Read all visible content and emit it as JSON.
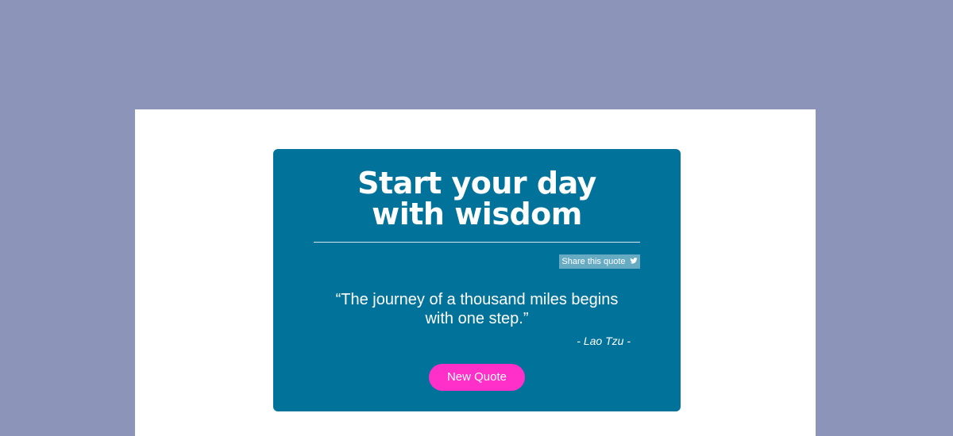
{
  "card": {
    "title_line1": "Start your day",
    "title_line2": "with wisdom",
    "share_label": "Share this quote",
    "share_icon": "twitter-bird-icon",
    "quote_line1": "“The journey of a thousand miles begins",
    "quote_line2": "with one step.”",
    "author": "- Lao Tzu -",
    "new_quote_label": "New Quote"
  },
  "colors": {
    "background": "#8c95b9",
    "page": "#ffffff",
    "card": "#01739a",
    "share_button": "#66abc2",
    "new_quote_button": "#ff2fc9"
  }
}
